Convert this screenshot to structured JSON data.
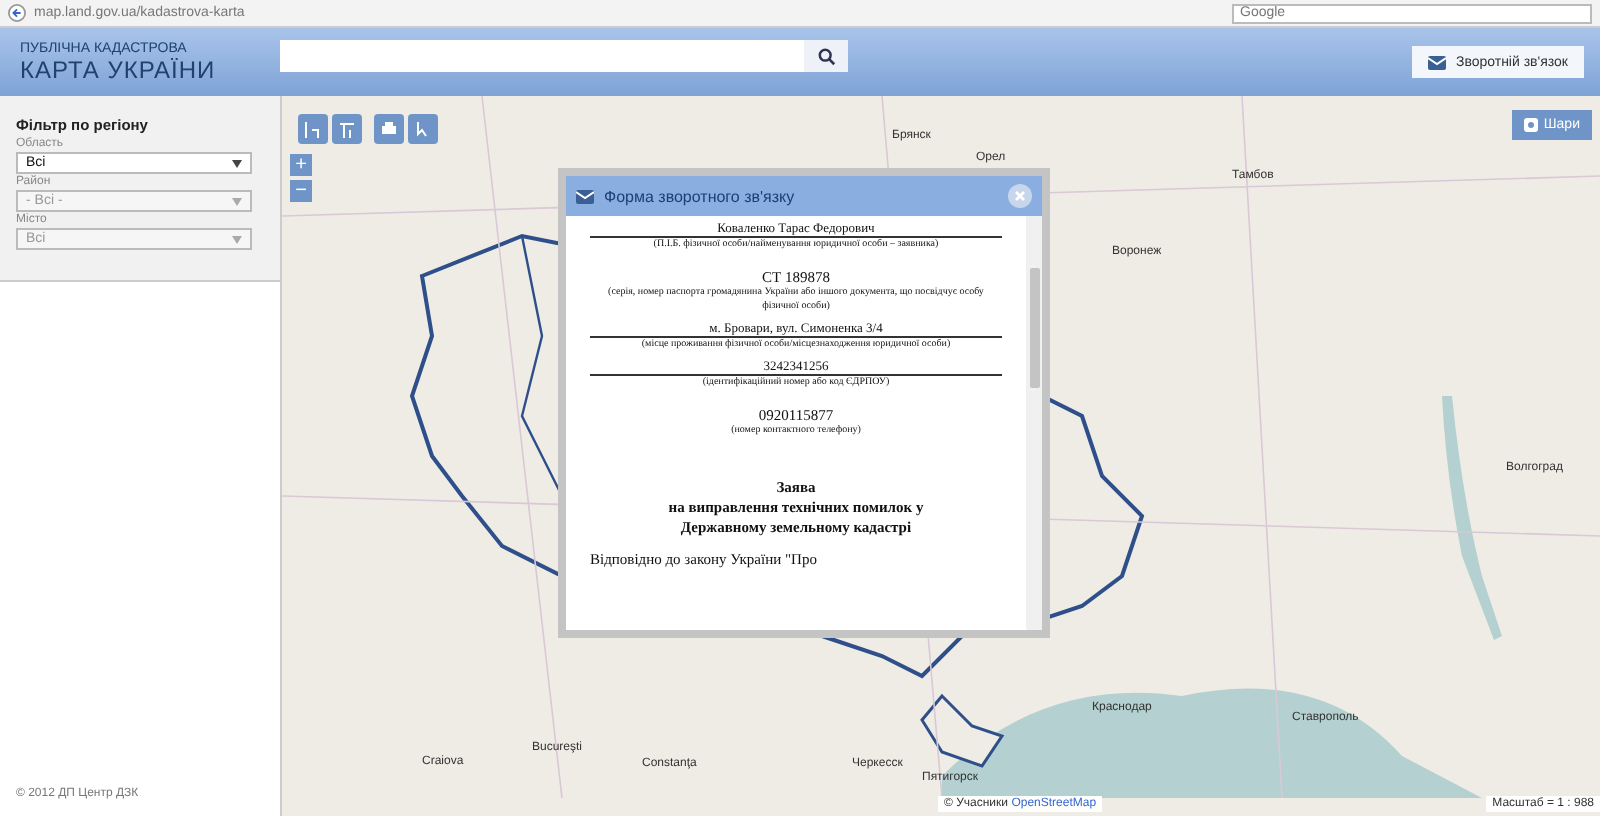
{
  "browser": {
    "address": "map.land.gov.ua/kadastrova-karta",
    "search_placeholder": "Google"
  },
  "header": {
    "title_top": "ПУБЛІЧНА КАДАСТРОВА",
    "title_main": "КАРТА УКРАЇНИ",
    "feedback_button": "Зворотній зв'язок"
  },
  "sidebar": {
    "title": "Фільтр по регіону",
    "filters": [
      {
        "label": "Область",
        "value": "Всі",
        "disabled": false
      },
      {
        "label": "Район",
        "value": "- Всі -",
        "disabled": true
      },
      {
        "label": "Місто",
        "value": "Всі",
        "disabled": true
      }
    ],
    "copyright": "© 2012 ДП Центр ДЗК"
  },
  "map": {
    "layers_button": "Шари",
    "zoom_in": "+",
    "zoom_out": "−",
    "labels": [
      "Брянск",
      "Орел",
      "Тамбов",
      "Воронеж",
      "Волгоград",
      "Краснодар",
      "Ставрополь",
      "Черкесск",
      "Пятигорск",
      "Bucureşti",
      "Craiova",
      "Constanţa"
    ],
    "attribution_prefix": "© Учасники",
    "attribution_link": "OpenStreetMap",
    "scale": "Масштаб = 1 : 988"
  },
  "dialog": {
    "title": "Форма зворотного зв'язку",
    "lines": [
      {
        "kind": "field",
        "text": "Коваленко Тарас Федорович"
      },
      {
        "kind": "note",
        "text": "(П.І.Б. фізичної особи/найменування юридичної особи – заявника)"
      },
      {
        "kind": "value",
        "text": "СТ 189878"
      },
      {
        "kind": "note",
        "text": "(серія, номер паспорта громадянина України або іншого документа, що посвідчує особу фізичної особи)"
      },
      {
        "kind": "field",
        "text": "м. Бровари, вул. Симоненка 3/4"
      },
      {
        "kind": "note",
        "text": "(місце проживання фізичної особи/місцезнаходження юридичної особи)"
      },
      {
        "kind": "field",
        "text": "3242341256"
      },
      {
        "kind": "note",
        "text": "(ідентифікаційний номер або код ЄДРПОУ)"
      },
      {
        "kind": "value",
        "text": "0920115877"
      },
      {
        "kind": "note",
        "text": "(номер контактного телефону)"
      },
      {
        "kind": "heading",
        "text": "Заява"
      },
      {
        "kind": "heading",
        "text": "на виправлення технічних помилок у"
      },
      {
        "kind": "heading",
        "text": "Державному земельному кадастрі"
      },
      {
        "kind": "body",
        "text": "Відповідно до закону України \"Про"
      }
    ]
  }
}
